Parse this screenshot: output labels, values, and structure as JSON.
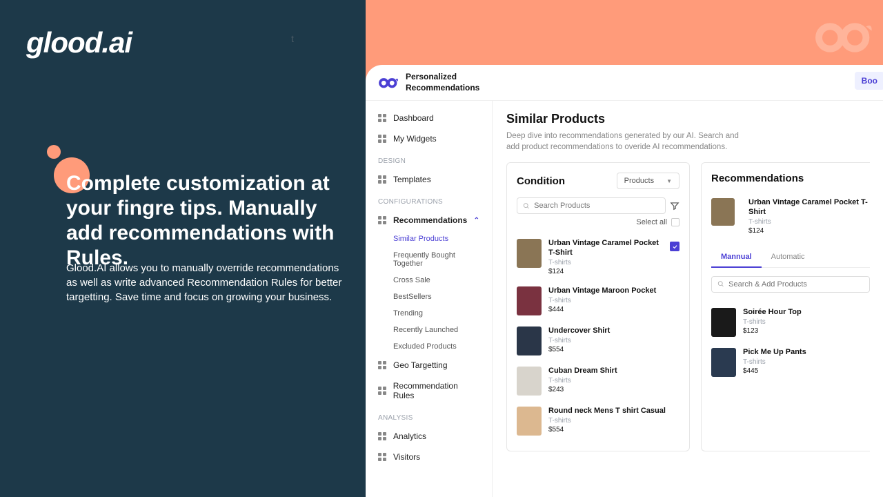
{
  "hero": {
    "logo": "glood.ai",
    "letterT": "t",
    "title": "Complete customization at your fingre tips. Manually add recommendations with Rules.",
    "body": "Glood.AI allows you to manually override recommendations as well as write advanced Recommendation Rules for better targetting. Save time and focus on growing your business."
  },
  "app": {
    "title1": "Personalized",
    "title2": "Recommendations",
    "cornerBtn": "Boo",
    "sidebar": {
      "items": [
        {
          "label": "Dashboard"
        },
        {
          "label": "My Widgets"
        }
      ],
      "headingDesign": "DESIGN",
      "templates": "Templates",
      "headingConfig": "CONFIGURATIONS",
      "recommendations": "Recommendations",
      "subitems": [
        "Similar Products",
        "Frequently Bought Together",
        "Cross Sale",
        "BestSellers",
        "Trending",
        "Recently Launched",
        "Excluded Products"
      ],
      "geo": "Geo Targetting",
      "rules": "Recommendation Rules",
      "headingAnalysis": "ANALYSIS",
      "analytics": "Analytics",
      "visitors": "Visitors"
    },
    "page": {
      "title": "Similar Products",
      "subtitle": "Deep dive into recommendations generated by our AI. Search and add product recommendations to overide AI recommendations."
    },
    "condition": {
      "title": "Condition",
      "dropdown": "Products",
      "searchPlaceholder": "Search Products",
      "selectAll": "Select all",
      "products": [
        {
          "name": "Urban Vintage Caramel Pocket T-Shirt",
          "cat": "T-shirts",
          "price": "$124",
          "color": "#8a7555",
          "checked": true
        },
        {
          "name": "Urban Vintage Maroon Pocket",
          "cat": "T-shirts",
          "price": "$444",
          "color": "#7a3240"
        },
        {
          "name": "Undercover Shirt",
          "cat": "T-shirts",
          "price": "$554",
          "color": "#2a3648"
        },
        {
          "name": "Cuban Dream Shirt",
          "cat": "T-shirts",
          "price": "$243",
          "color": "#d8d4cc"
        },
        {
          "name": "Round neck Mens T shirt Casual",
          "cat": "T-shirts",
          "price": "$554",
          "color": "#dcb890"
        }
      ]
    },
    "recommendations": {
      "title": "Recommendations",
      "topProduct": {
        "name": "Urban Vintage Caramel Pocket T-Shirt",
        "cat": "T-shirts",
        "price": "$124",
        "color": "#8a7555"
      },
      "tabs": {
        "manual": "Mannual",
        "automatic": "Automatic"
      },
      "searchPlaceholder": "Search & Add Products",
      "products": [
        {
          "name": "Soirée Hour Top",
          "cat": "T-shirts",
          "price": "$123",
          "color": "#1a1a1a"
        },
        {
          "name": "Pick Me Up Pants",
          "cat": "T-shirts",
          "price": "$445",
          "color": "#2a3a50"
        }
      ]
    }
  }
}
